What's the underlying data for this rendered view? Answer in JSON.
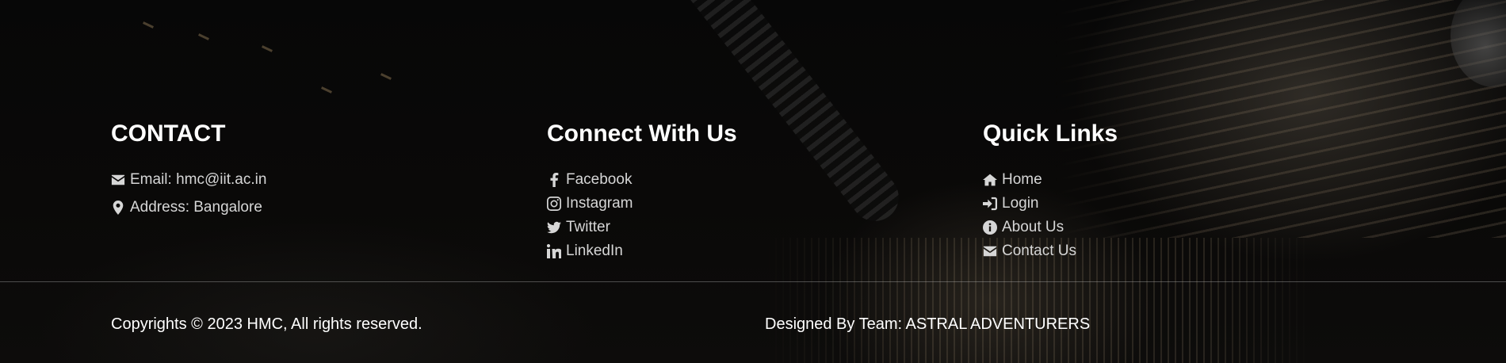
{
  "contact": {
    "title": "CONTACT",
    "items": [
      {
        "icon": "envelope-icon",
        "text": "Email: hmc@iit.ac.in"
      },
      {
        "icon": "location-pin-icon",
        "text": "Address: Bangalore"
      }
    ]
  },
  "connect": {
    "title": "Connect With Us",
    "items": [
      {
        "icon": "facebook-icon",
        "text": "Facebook"
      },
      {
        "icon": "instagram-icon",
        "text": "Instagram"
      },
      {
        "icon": "twitter-icon",
        "text": "Twitter"
      },
      {
        "icon": "linkedin-icon",
        "text": "LinkedIn"
      }
    ]
  },
  "quick_links": {
    "title": "Quick Links",
    "items": [
      {
        "icon": "home-icon",
        "text": "Home"
      },
      {
        "icon": "sign-in-icon",
        "text": "Login"
      },
      {
        "icon": "info-icon",
        "text": "About Us"
      },
      {
        "icon": "envelope-icon",
        "text": "Contact Us"
      }
    ]
  },
  "bottom": {
    "copyright": "Copyrights © 2023 HMC, All rights reserved.",
    "designed_by": "Designed By Team: ASTRAL ADVENTURERS"
  },
  "colors": {
    "background": "#050505",
    "heading": "#ffffff",
    "link_text": "#d6d6d6",
    "divider": "#5a5a5a"
  }
}
